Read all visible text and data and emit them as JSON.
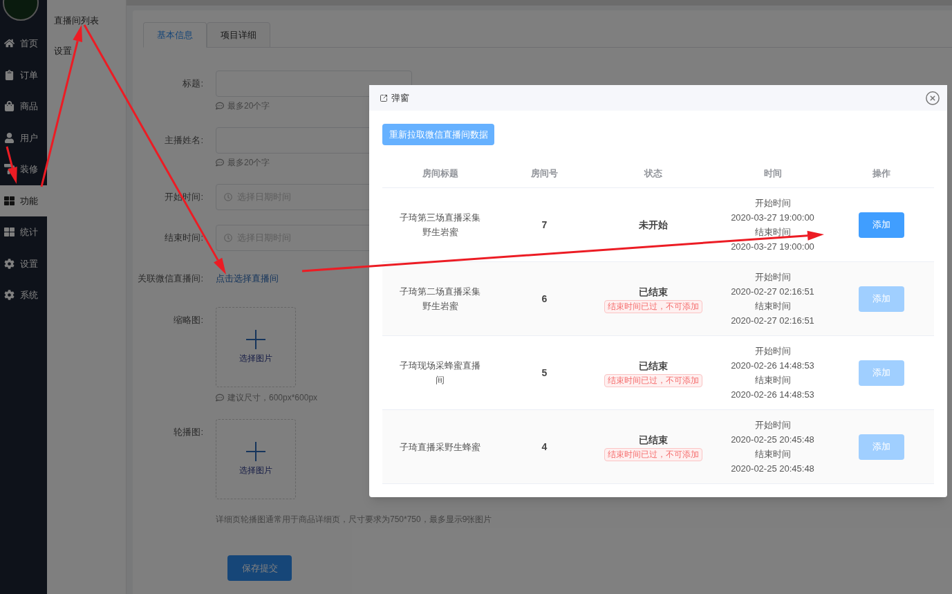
{
  "sidebar": {
    "items": [
      {
        "label": "首页",
        "selected": false
      },
      {
        "label": "订单",
        "selected": false
      },
      {
        "label": "商品",
        "selected": false
      },
      {
        "label": "用户",
        "selected": false
      },
      {
        "label": "装修",
        "selected": false
      },
      {
        "label": "功能",
        "selected": true
      },
      {
        "label": "统计",
        "selected": false
      },
      {
        "label": "设置",
        "selected": false
      },
      {
        "label": "系统",
        "selected": false
      }
    ]
  },
  "submenu": {
    "items": [
      {
        "label": "直播间列表"
      },
      {
        "label": "设置"
      }
    ]
  },
  "tabs": [
    {
      "label": "基本信息",
      "selected": true
    },
    {
      "label": "项目详细",
      "selected": false
    }
  ],
  "form": {
    "fields": [
      {
        "kind": "text",
        "label": "标题:",
        "hint": "最多20个字"
      },
      {
        "kind": "text",
        "label": "主播姓名:",
        "hint": "最多20个字"
      },
      {
        "kind": "datetime",
        "label": "开始时间:",
        "placeholder": "选择日期时间"
      },
      {
        "kind": "datetime",
        "label": "结束时间:",
        "placeholder": "选择日期时间"
      },
      {
        "kind": "link",
        "label": "关联微信直播间:",
        "value": "点击选择直播间"
      },
      {
        "kind": "upload",
        "label": "缩略图:",
        "button": "选择图片",
        "hint": "建议尺寸，600px*600px"
      },
      {
        "kind": "upload",
        "label": "轮播图:",
        "button": "选择图片",
        "note": "详细页轮播图通常用于商品详细页，尺寸要求为750*750，最多显示9张图片"
      }
    ],
    "submit": "保存提交"
  },
  "modal": {
    "title": "弹窗",
    "refresh_button": "重新拉取微信直播间数据",
    "columns": [
      "房间标题",
      "房间号",
      "状态",
      "时间",
      "操作"
    ],
    "rows": [
      {
        "title": "子琦第三场直播采集野生岩蜜",
        "room": "7",
        "status": "未开始",
        "start_label": "开始时间",
        "start": "2020-03-27 19:00:00",
        "end_label": "结束时间",
        "end": "2020-03-27 19:00:00",
        "action": "添加",
        "disabled": false
      },
      {
        "title": "子琦第二场直播采集野生岩蜜",
        "room": "6",
        "status": "已结束",
        "warning": "结束时间已过，不可添加",
        "start_label": "开始时间",
        "start": "2020-02-27 02:16:51",
        "end_label": "结束时间",
        "end": "2020-02-27 02:16:51",
        "action": "添加",
        "disabled": true
      },
      {
        "title": "子琦现场采蜂蜜直播间",
        "room": "5",
        "status": "已结束",
        "warning": "结束时间已过，不可添加",
        "start_label": "开始时间",
        "start": "2020-02-26 14:48:53",
        "end_label": "结束时间",
        "end": "2020-02-26 14:48:53",
        "action": "添加",
        "disabled": true
      },
      {
        "title": "子琦直播采野生蜂蜜",
        "room": "4",
        "status": "已结束",
        "warning": "结束时间已过，不可添加",
        "start_label": "开始时间",
        "start": "2020-02-25 20:45:48",
        "end_label": "结束时间",
        "end": "2020-02-25 20:45:48",
        "action": "添加",
        "disabled": true
      }
    ]
  }
}
